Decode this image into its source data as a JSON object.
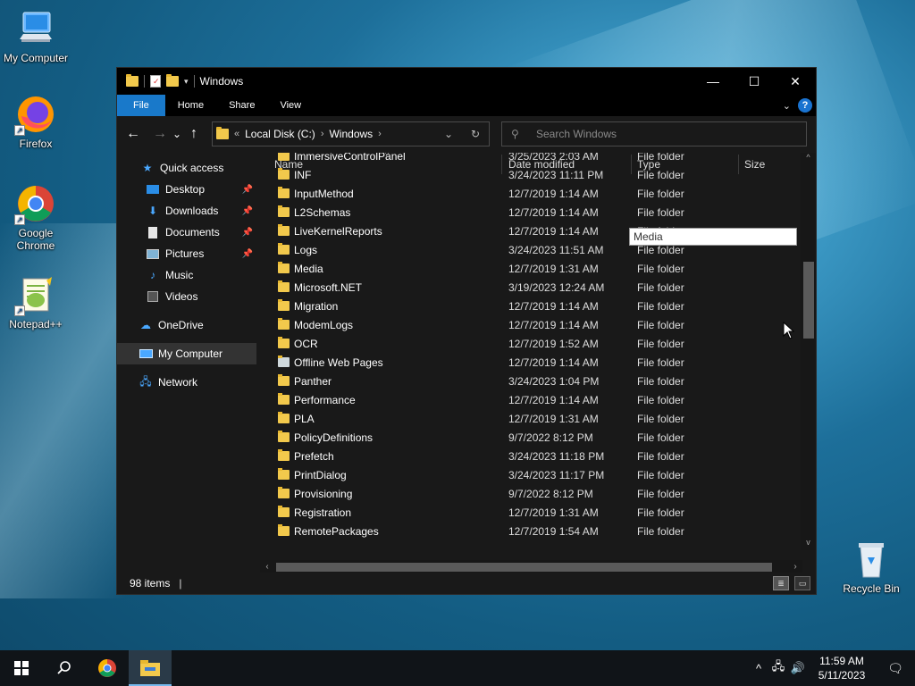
{
  "desktop": {
    "icons": [
      {
        "label": "My Computer",
        "icon": "my-computer-icon"
      },
      {
        "label": "Firefox",
        "icon": "firefox-icon"
      },
      {
        "label": "Google Chrome",
        "icon": "chrome-icon"
      },
      {
        "label": "Notepad++",
        "icon": "notepadpp-icon"
      },
      {
        "label": "Recycle Bin",
        "icon": "recycle-bin-icon"
      }
    ]
  },
  "window": {
    "title": "Windows",
    "controls": {
      "minimize": "—",
      "maximize": "☐",
      "close": "✕"
    },
    "ribbon": {
      "tabs": [
        "File",
        "Home",
        "Share",
        "View"
      ],
      "help": "?"
    },
    "nav": {
      "back": "←",
      "forward": "→",
      "recent": "⌄",
      "up": "↑",
      "address": {
        "overflow": "«",
        "crumbs": [
          "Local Disk (C:)",
          "Windows"
        ]
      },
      "search_placeholder": "Search Windows"
    },
    "navpane": {
      "items": [
        {
          "label": "Quick access",
          "icon": "star-icon",
          "pinned": false
        },
        {
          "label": "Desktop",
          "icon": "desktop-icon",
          "pinned": true
        },
        {
          "label": "Downloads",
          "icon": "downloads-icon",
          "pinned": true
        },
        {
          "label": "Documents",
          "icon": "documents-icon",
          "pinned": true
        },
        {
          "label": "Pictures",
          "icon": "pictures-icon",
          "pinned": true
        },
        {
          "label": "Music",
          "icon": "music-icon",
          "pinned": false
        },
        {
          "label": "Videos",
          "icon": "videos-icon",
          "pinned": false
        },
        {
          "label": "OneDrive",
          "icon": "onedrive-icon",
          "pinned": false
        },
        {
          "label": "My Computer",
          "icon": "computer-icon",
          "pinned": false,
          "selected": true
        },
        {
          "label": "Network",
          "icon": "network-icon",
          "pinned": false
        }
      ]
    },
    "columns": {
      "name": "Name",
      "date": "Date modified",
      "type": "Type",
      "size": "Size"
    },
    "files": [
      {
        "name": "ImmersiveControlPanel",
        "date": "3/25/2023 2:03 AM",
        "type": "File folder"
      },
      {
        "name": "INF",
        "date": "3/24/2023 11:11 PM",
        "type": "File folder"
      },
      {
        "name": "InputMethod",
        "date": "12/7/2019 1:14 AM",
        "type": "File folder"
      },
      {
        "name": "L2Schemas",
        "date": "12/7/2019 1:14 AM",
        "type": "File folder"
      },
      {
        "name": "LiveKernelReports",
        "date": "12/7/2019 1:14 AM",
        "type": "File folder"
      },
      {
        "name": "Logs",
        "date": "3/24/2023 11:51 AM",
        "type": "File folder"
      },
      {
        "name": "Media",
        "date": "12/7/2019 1:31 AM",
        "type": "File folder"
      },
      {
        "name": "Microsoft.NET",
        "date": "3/19/2023 12:24 AM",
        "type": "File folder"
      },
      {
        "name": "Migration",
        "date": "12/7/2019 1:14 AM",
        "type": "File folder"
      },
      {
        "name": "ModemLogs",
        "date": "12/7/2019 1:14 AM",
        "type": "File folder"
      },
      {
        "name": "OCR",
        "date": "12/7/2019 1:52 AM",
        "type": "File folder"
      },
      {
        "name": "Offline Web Pages",
        "date": "12/7/2019 1:14 AM",
        "type": "File folder",
        "special": true
      },
      {
        "name": "Panther",
        "date": "3/24/2023 1:04 PM",
        "type": "File folder"
      },
      {
        "name": "Performance",
        "date": "12/7/2019 1:14 AM",
        "type": "File folder"
      },
      {
        "name": "PLA",
        "date": "12/7/2019 1:31 AM",
        "type": "File folder"
      },
      {
        "name": "PolicyDefinitions",
        "date": "9/7/2022 8:12 PM",
        "type": "File folder"
      },
      {
        "name": "Prefetch",
        "date": "3/24/2023 11:18 PM",
        "type": "File folder"
      },
      {
        "name": "PrintDialog",
        "date": "3/24/2023 11:17 PM",
        "type": "File folder"
      },
      {
        "name": "Provisioning",
        "date": "9/7/2022 8:12 PM",
        "type": "File folder"
      },
      {
        "name": "Registration",
        "date": "12/7/2019 1:31 AM",
        "type": "File folder"
      },
      {
        "name": "RemotePackages",
        "date": "12/7/2019 1:54 AM",
        "type": "File folder"
      }
    ],
    "tooltip": "Media",
    "status": {
      "count": "98 items",
      "cursor": "|"
    }
  },
  "taskbar": {
    "start": "start-icon",
    "search": "search-icon",
    "apps": [
      "chrome-icon",
      "file-explorer-icon"
    ],
    "tray": {
      "time": "11:59 AM",
      "date": "5/11/2023",
      "chevron": "^",
      "network": "🖧",
      "volume": "🔊"
    }
  }
}
